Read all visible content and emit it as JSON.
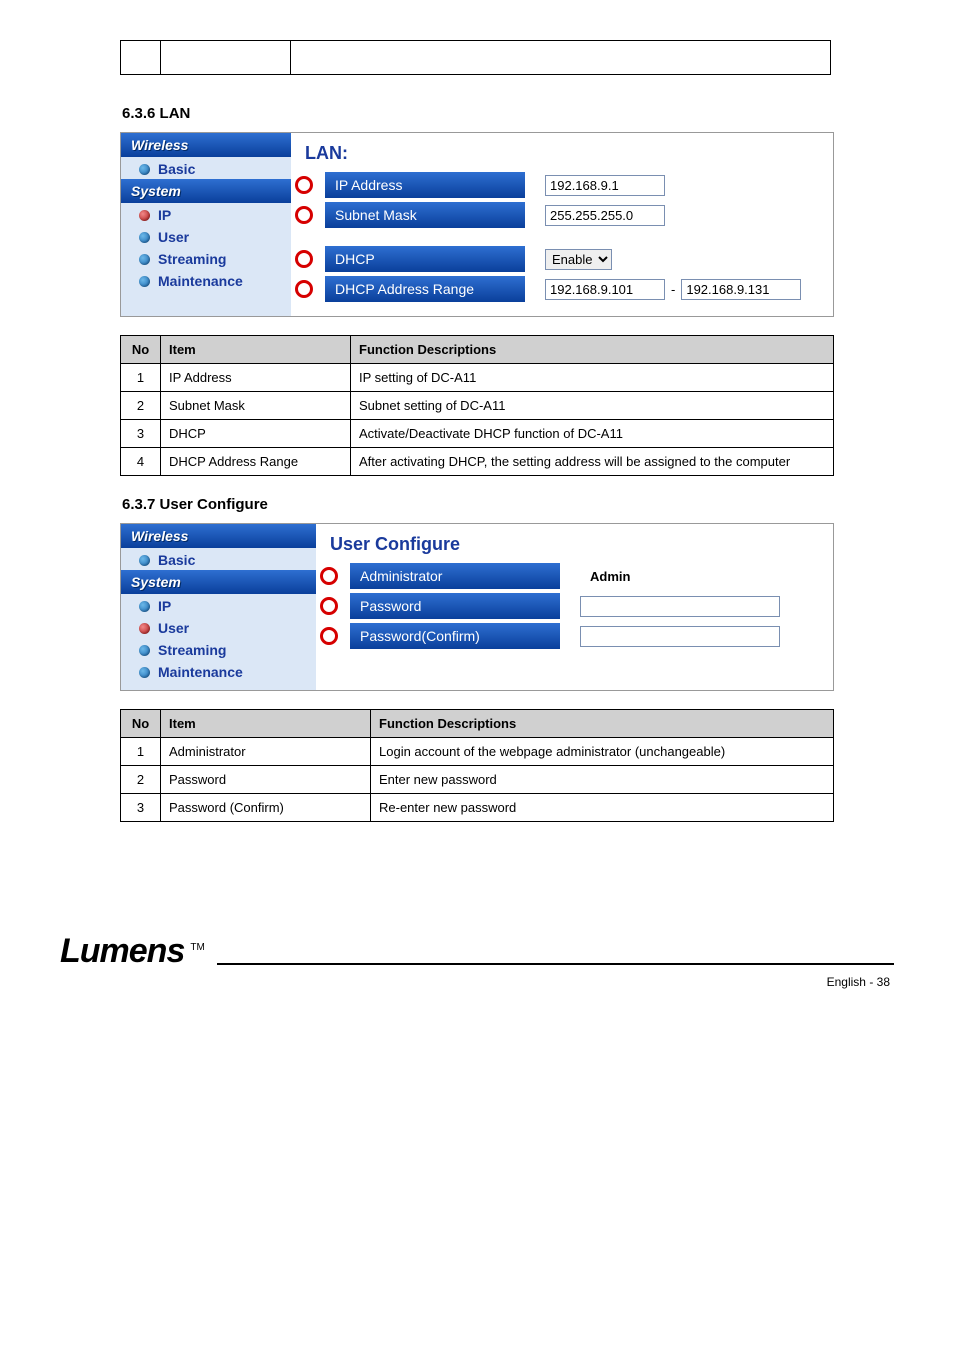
{
  "top_table": {
    "cells": [
      "",
      "",
      ""
    ]
  },
  "lan_section_heading": "6.3.6 LAN",
  "user_section_heading": "6.3.7 User Configure",
  "sidebar": {
    "wireless_header": "Wireless",
    "basic": "Basic",
    "system_header": "System",
    "ip": "IP",
    "user": "User",
    "streaming": "Streaming",
    "maintenance": "Maintenance"
  },
  "lan_panel": {
    "title": "LAN:",
    "ip_address_label": "IP Address",
    "ip_address_value": "192.168.9.1",
    "subnet_mask_label": "Subnet Mask",
    "subnet_mask_value": "255.255.255.0",
    "dhcp_label": "DHCP",
    "dhcp_value": "Enable",
    "dhcp_range_label": "DHCP Address Range",
    "dhcp_range_from": "192.168.9.101",
    "dhcp_range_to": "192.168.9.131",
    "range_sep": "-"
  },
  "lan_desc": {
    "headers": {
      "no": "No",
      "item": "Item",
      "desc": "Function Descriptions"
    },
    "rows": [
      {
        "no": "1",
        "item": "IP Address",
        "desc": "IP setting of DC-A11"
      },
      {
        "no": "2",
        "item": "Subnet Mask",
        "desc": "Subnet setting of DC-A11"
      },
      {
        "no": "3",
        "item": "DHCP",
        "desc": "Activate/Deactivate DHCP function of DC-A11"
      },
      {
        "no": "4",
        "item": "DHCP Address Range",
        "desc": "After activating DHCP, the setting address will be assigned to the computer"
      }
    ]
  },
  "user_panel": {
    "title": "User Configure",
    "admin_label": "Administrator",
    "admin_value": "Admin",
    "password_label": "Password",
    "password_confirm_label": "Password(Confirm)"
  },
  "user_desc": {
    "headers": {
      "no": "No",
      "item": "Item",
      "desc": "Function Descriptions"
    },
    "rows": [
      {
        "no": "1",
        "item": "Administrator",
        "desc": "Login account of the webpage administrator (unchangeable)"
      },
      {
        "no": "2",
        "item": "Password",
        "desc": "Enter new password"
      },
      {
        "no": "3",
        "item": "Password (Confirm)",
        "desc": "Re-enter new password"
      }
    ]
  },
  "footer": {
    "logo_text": "Lumens",
    "tm": "TM",
    "page_label": "English - 38"
  }
}
